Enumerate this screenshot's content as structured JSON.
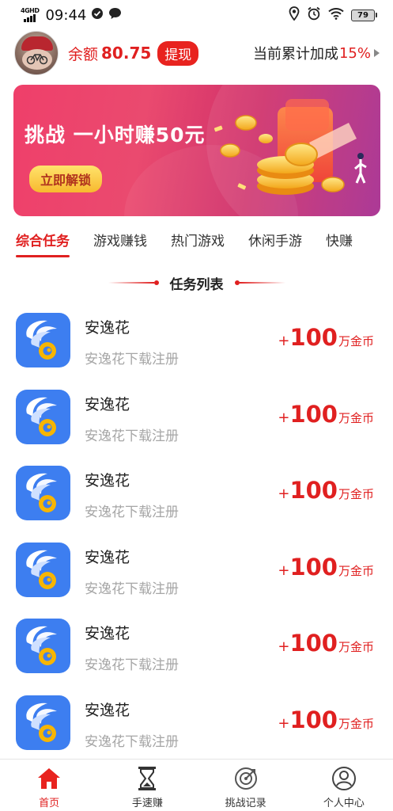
{
  "status_bar": {
    "network_label": "4GHD",
    "time": "09:44",
    "battery": "79",
    "icons": [
      "signal-icon",
      "shield-check-icon",
      "chat-bubble-icon",
      "location-icon",
      "alarm-icon",
      "wifi-icon",
      "battery-icon"
    ]
  },
  "header": {
    "balance_label": "余额",
    "balance_value": "80.75",
    "withdraw_label": "提现",
    "bonus_label": "当前累计加成",
    "bonus_value": "15%"
  },
  "banner": {
    "title": "挑战  一小时赚50元",
    "button_label": "立即解锁"
  },
  "tabs": [
    {
      "label": "综合任务",
      "active": true
    },
    {
      "label": "游戏赚钱",
      "active": false
    },
    {
      "label": "热门游戏",
      "active": false
    },
    {
      "label": "休闲手游",
      "active": false
    },
    {
      "label": "快赚",
      "active": false
    }
  ],
  "section_title": "任务列表",
  "tasks": [
    {
      "name": "安逸花",
      "desc": "安逸花下载注册",
      "plus": "+",
      "reward": "100",
      "unit": "万金币"
    },
    {
      "name": "安逸花",
      "desc": "安逸花下载注册",
      "plus": "+",
      "reward": "100",
      "unit": "万金币"
    },
    {
      "name": "安逸花",
      "desc": "安逸花下载注册",
      "plus": "+",
      "reward": "100",
      "unit": "万金币"
    },
    {
      "name": "安逸花",
      "desc": "安逸花下载注册",
      "plus": "+",
      "reward": "100",
      "unit": "万金币"
    },
    {
      "name": "安逸花",
      "desc": "安逸花下载注册",
      "plus": "+",
      "reward": "100",
      "unit": "万金币"
    },
    {
      "name": "安逸花",
      "desc": "安逸花下载注册",
      "plus": "+",
      "reward": "100",
      "unit": "万金币"
    }
  ],
  "bottom_nav": [
    {
      "label": "首页",
      "icon": "home-icon",
      "active": true
    },
    {
      "label": "手速赚",
      "icon": "hourglass-icon",
      "active": false
    },
    {
      "label": "挑战记录",
      "icon": "target-icon",
      "active": false
    },
    {
      "label": "个人中心",
      "icon": "user-icon",
      "active": false
    }
  ],
  "colors": {
    "accent": "#e02020",
    "app_icon": "#3d7ef0",
    "banner_start": "#ef3f6a",
    "banner_end": "#a52a8e"
  }
}
